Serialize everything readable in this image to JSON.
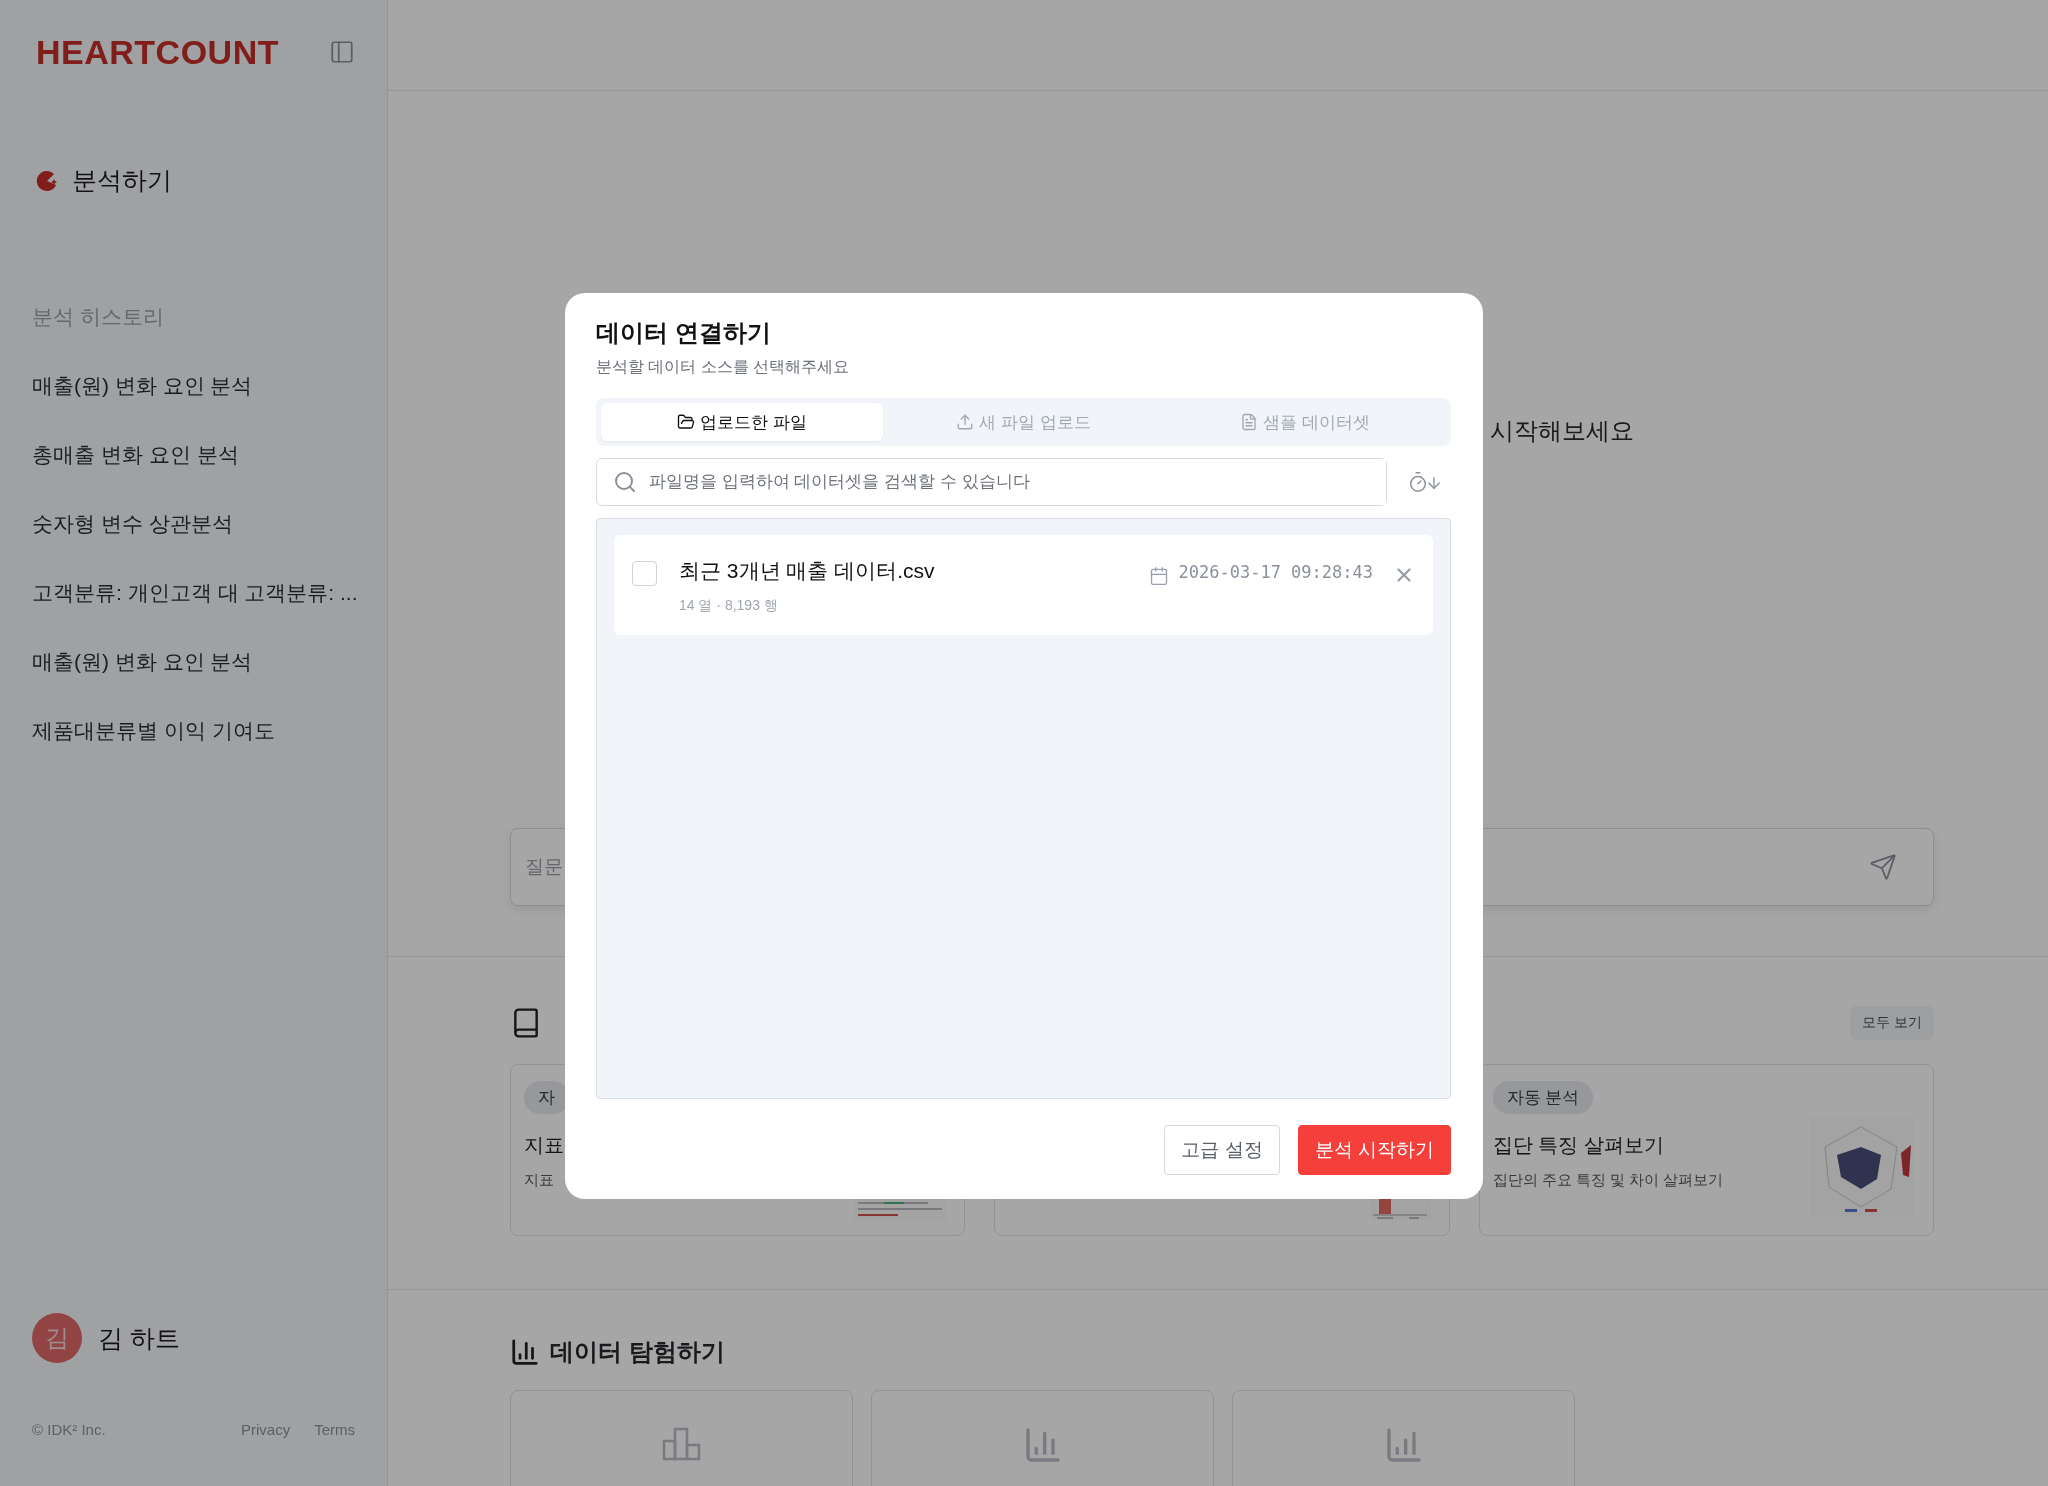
{
  "sidebar": {
    "logo": "HEARTCOUNT",
    "new_analysis": "분석하기",
    "history_title": "분석 히스토리",
    "history": [
      "매출(원) 변화 요인 분석",
      "총매출 변화 요인 분석",
      "숫자형 변수 상관분석",
      "고객분류: 개인고객 대 고객분류: ...",
      "매출(원) 변화 요인 분석",
      "제품대분류별 이익 기여도"
    ],
    "user": {
      "initial": "김",
      "name": "김 하트"
    },
    "footer": {
      "copyright": "© IDK² Inc.",
      "links": [
        "Privacy",
        "Terms"
      ]
    }
  },
  "main": {
    "hero_text": "시작해보세요",
    "question_placeholder": "질문",
    "recommended": {
      "view_all": "모두 보기",
      "cards": [
        {
          "kind": "text_lines",
          "badge": "자",
          "title": "지표",
          "description": "지표"
        },
        {
          "kind": "bar_chart"
        },
        {
          "kind": "radar_chart",
          "badge": "자동 분석",
          "title": "집단 특징 살펴보기",
          "description": "집단의 주요 특징 및 차이 살펴보기"
        }
      ]
    },
    "explore": {
      "title": "데이터 탐험하기"
    }
  },
  "dialog": {
    "title": "데이터 연결하기",
    "subtitle": "분석할 데이터 소스를 선택해주세요",
    "tabs": [
      {
        "label": "업로드한 파일",
        "selected": true
      },
      {
        "label": "새 파일 업로드",
        "selected": false
      },
      {
        "label": "샘플 데이터셋",
        "selected": false
      }
    ],
    "search": {
      "placeholder": "파일명을 입력하여 데이터셋을 검색할 수 있습니다"
    },
    "files": [
      {
        "name": "최근 3개년 매출 데이터.csv",
        "meta": "14 열 · 8,193 행",
        "date": "2026-03-17 09:28:43",
        "checked": false
      }
    ],
    "buttons": [
      {
        "label": "고급 설정",
        "kind": "secondary"
      },
      {
        "label": "분석 시작하기",
        "kind": "primary"
      }
    ]
  }
}
